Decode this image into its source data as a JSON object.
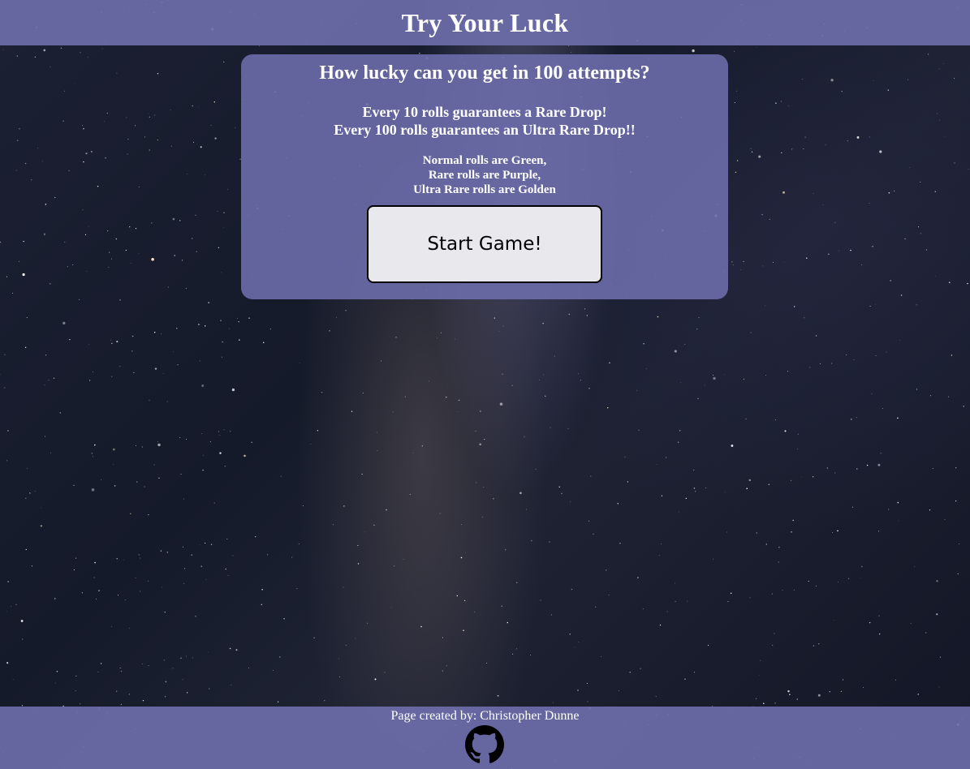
{
  "header": {
    "title": "Try Your Luck"
  },
  "panel": {
    "question": "How lucky can you get in 100 attempts?",
    "guarantee_lines": [
      "Every 10 rolls guarantees a Rare Drop!",
      "Every 100 rolls guarantees an Ultra Rare Drop!!"
    ],
    "color_lines": [
      "Normal rolls are Green,",
      "Rare rolls are Purple,",
      "Ultra Rare rolls are Golden"
    ],
    "start_button_label": "Start Game!"
  },
  "footer": {
    "credit": "Page created by: Christopher Dunne",
    "github_icon": "github-icon"
  },
  "colors": {
    "bar_background": "#6c6caa",
    "button_background": "#e9e8ed",
    "text": "#ffffff"
  }
}
